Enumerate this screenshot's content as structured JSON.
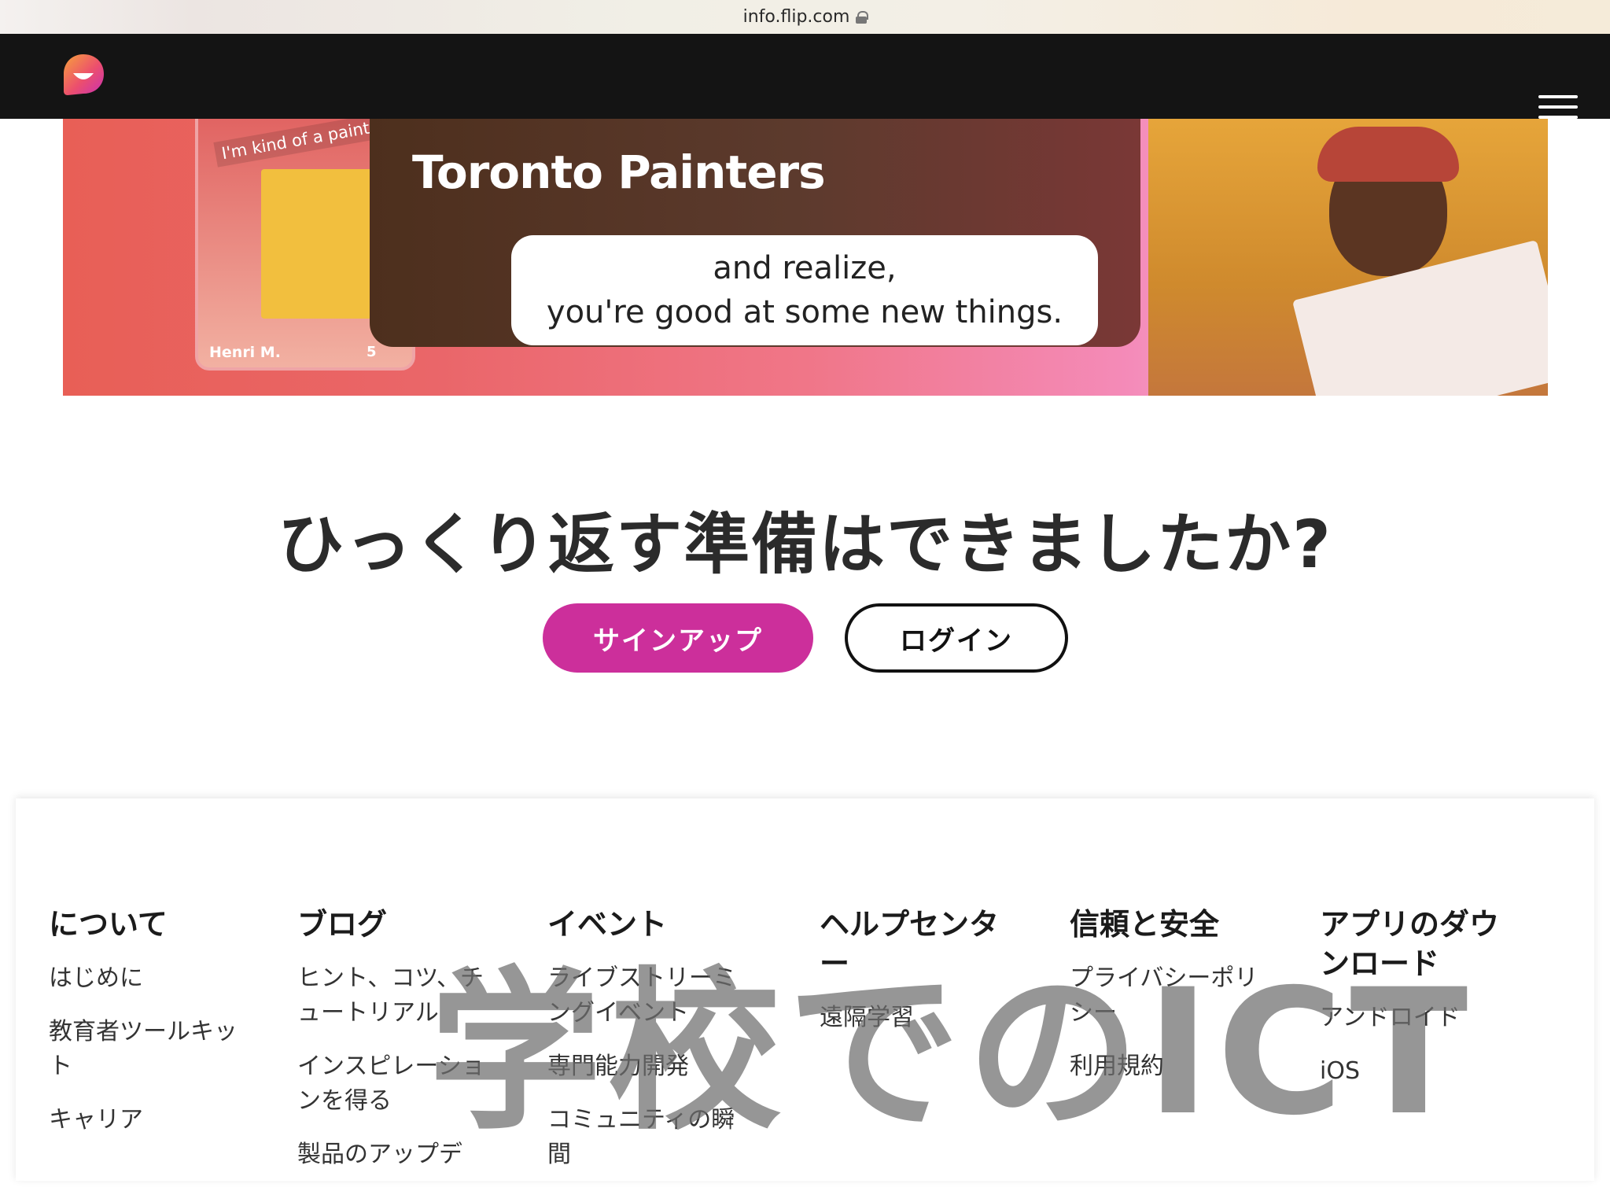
{
  "browser": {
    "url": "info.flip.com"
  },
  "nav": {
    "logo_icon": "flip-logo-icon",
    "menu_icon": "hamburger-menu-icon"
  },
  "hero": {
    "sticker": "I'm kind of a painter now!",
    "author": "Henri M.",
    "comments": "5",
    "video_title": "Toronto Painters",
    "caption_line1": "and realize,",
    "caption_line2": "you're good at some new things."
  },
  "cta": {
    "title": "ひっくり返す準備はできましたか?",
    "signup_label": "サインアップ",
    "login_label": "ログイン"
  },
  "footer": {
    "columns": [
      {
        "title": "について",
        "links": [
          "はじめに",
          "教育者ツールキット",
          "キャリア"
        ]
      },
      {
        "title": "ブログ",
        "links": [
          "ヒント、コツ、チュートリアル",
          "インスピレーションを得る",
          "製品のアップデ"
        ]
      },
      {
        "title": "イベント",
        "links": [
          "ライブストリーミングイベント",
          "専門能力開発",
          "コミュニティの瞬間"
        ]
      },
      {
        "title": "ヘルプセンター",
        "links": [
          "遠隔学習"
        ]
      },
      {
        "title": "信頼と安全",
        "links": [
          "プライバシーポリシー",
          "利用規約"
        ]
      },
      {
        "title": "アプリのダウンロード",
        "links": [
          "アンドロイド",
          "iOS"
        ]
      }
    ]
  },
  "watermark": "学校でのICT",
  "colors": {
    "accent": "#cc2f9b",
    "navbar": "#141414"
  }
}
